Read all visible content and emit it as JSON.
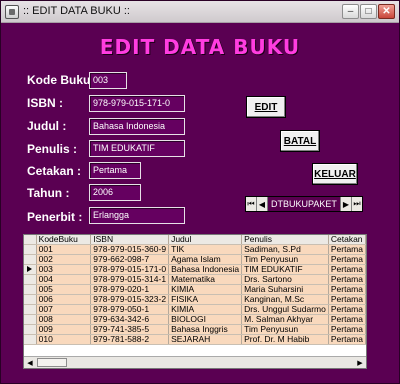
{
  "window": {
    "title": ":: EDIT DATA BUKU :: ",
    "minimize_glyph": "–",
    "maximize_glyph": "□",
    "close_glyph": "✕"
  },
  "heading": "EDIT DATA BUKU",
  "form": {
    "kode_label": "Kode Buku :",
    "kode_value": "003",
    "isbn_label": "ISBN :",
    "isbn_value": "978-979-015-171-0",
    "judul_label": "Judul :",
    "judul_value": "Bahasa Indonesia",
    "penulis_label": "Penulis :",
    "penulis_value": "TIM EDUKATIF",
    "cetakan_label": "Cetakan :",
    "cetakan_value": "Pertama",
    "tahun_label": "Tahun :",
    "tahun_value": "2006",
    "penerbit_label": "Penerbit :",
    "penerbit_value": "Erlangga"
  },
  "buttons": {
    "edit": "EDIT",
    "batal": "BATAL",
    "keluar": "KELUAR"
  },
  "data_control": {
    "caption": "DTBUKUPAKET",
    "first": "⏮",
    "prev": "◀",
    "next": "▶",
    "last": "⏭"
  },
  "grid": {
    "columns": [
      "KodeBuku",
      "ISBN",
      "Judul",
      "Penulis",
      "Cetakan"
    ],
    "selected_row": 2,
    "rows": [
      [
        "001",
        "978-979-015-360-9",
        "TIK",
        "Sadiman, S.Pd",
        "Pertama"
      ],
      [
        "002",
        "979-662-098-7",
        "Agama Islam",
        "Tim Penyusun",
        "Pertama"
      ],
      [
        "003",
        "978-979-015-171-0",
        "Bahasa Indonesia",
        "TIM EDUKATIF",
        "Pertama"
      ],
      [
        "004",
        "978-979-015-314-1",
        "Matematika",
        "Drs. Sartono",
        "Pertama"
      ],
      [
        "005",
        "978-979-020-1",
        "KIMIA",
        "Maria Suharsini",
        "Pertama"
      ],
      [
        "006",
        "978-979-015-323-2",
        "FISIKA",
        "Kanginan, M.Sc",
        "Pertama"
      ],
      [
        "007",
        "978-979-050-1",
        "KIMIA",
        "Drs. Unggul Sudarmo",
        "Pertama"
      ],
      [
        "008",
        "979-634-342-6",
        "BIOLOGI",
        "M. Salman Akhyar",
        "Pertama"
      ],
      [
        "009",
        "979-741-385-5",
        "Bahasa Inggris",
        "Tim Penyusun",
        "Pertama"
      ],
      [
        "010",
        "979-781-588-2",
        "SEJARAH",
        "Prof. Dr. M Habib",
        "Pertama"
      ]
    ],
    "scroll_left": "◀",
    "scroll_right": "▶"
  }
}
